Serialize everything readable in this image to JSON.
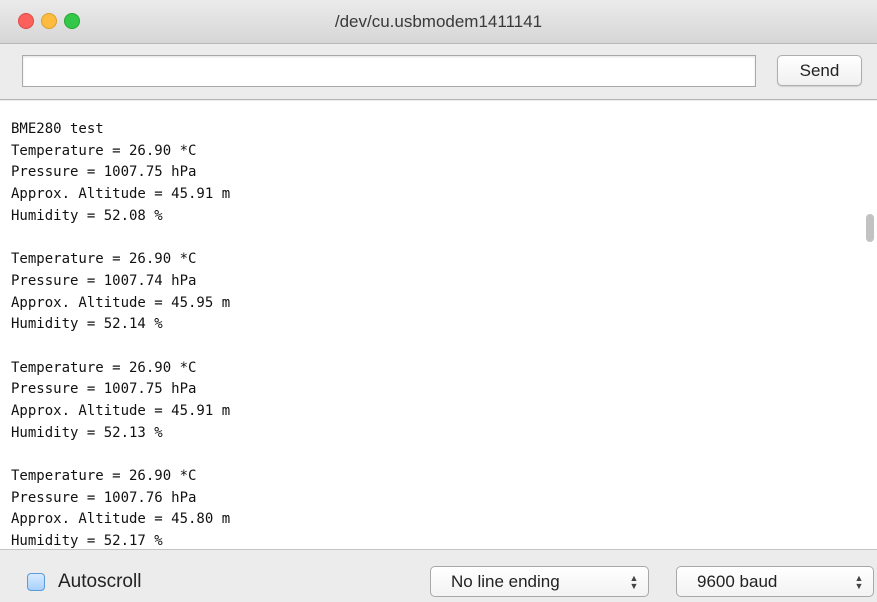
{
  "window": {
    "title": "/dev/cu.usbmodem1411141"
  },
  "toolbar": {
    "input_value": "",
    "send_label": "Send"
  },
  "output": {
    "lines": [
      "BME280 test",
      "Temperature = 26.90 *C",
      "Pressure = 1007.75 hPa",
      "Approx. Altitude = 45.91 m",
      "Humidity = 52.08 %",
      "",
      "Temperature = 26.90 *C",
      "Pressure = 1007.74 hPa",
      "Approx. Altitude = 45.95 m",
      "Humidity = 52.14 %",
      "",
      "Temperature = 26.90 *C",
      "Pressure = 1007.75 hPa",
      "Approx. Altitude = 45.91 m",
      "Humidity = 52.13 %",
      "",
      "Temperature = 26.90 *C",
      "Pressure = 1007.76 hPa",
      "Approx. Altitude = 45.80 m",
      "Humidity = 52.17 %"
    ]
  },
  "statusbar": {
    "autoscroll_label": "Autoscroll",
    "autoscroll_checked": false,
    "line_ending": "No line ending",
    "baud_rate": "9600 baud"
  },
  "colors": {
    "close": "#fc605c",
    "minimize": "#fdbc40",
    "maximize": "#34c84a",
    "checkbox_accent": "#5a9bd8"
  }
}
